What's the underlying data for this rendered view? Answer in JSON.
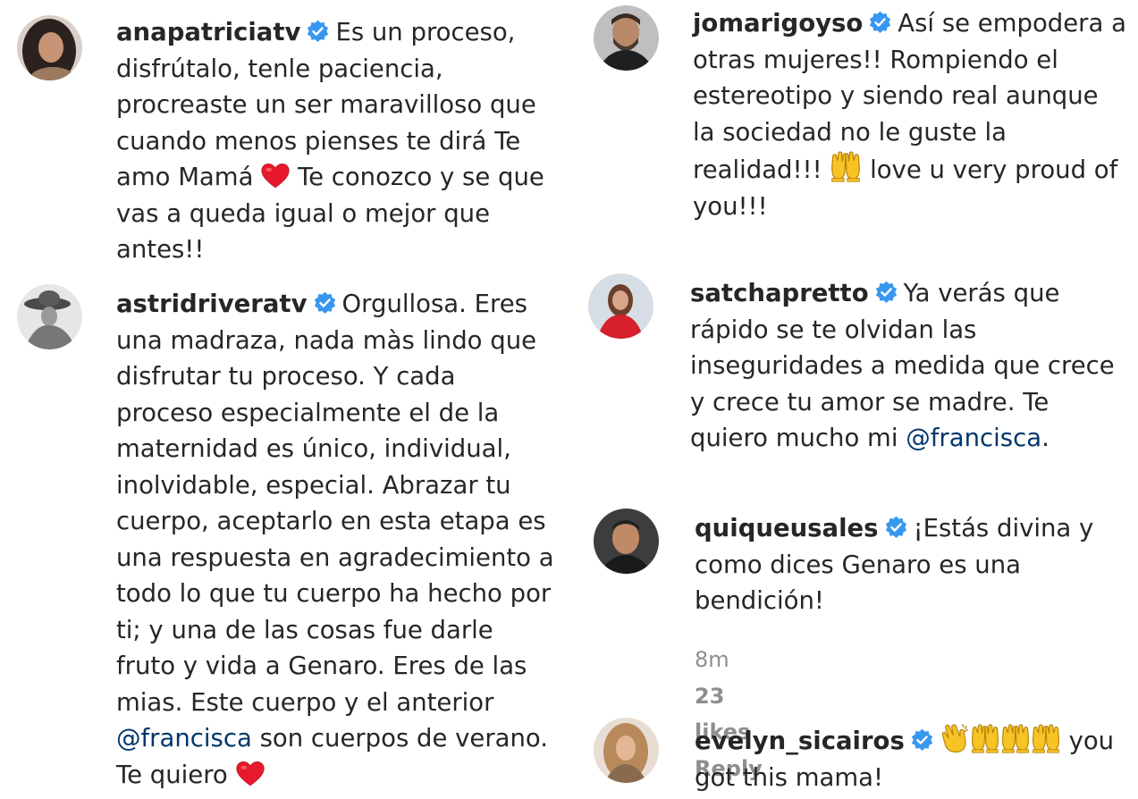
{
  "colors": {
    "mention": "#00376b",
    "verified": "#3897f0",
    "text": "#262626",
    "meta": "#8e8e8e",
    "heart": "#e8192c",
    "emoji_yellow": "#f7c325"
  },
  "icons": {
    "verified": "verified-badge-icon",
    "heart": "red-heart-emoji",
    "raised_hands": "raising-hands-emoji",
    "clap": "clapping-hands-emoji"
  },
  "comments": [
    {
      "username": "anapatriciatv",
      "text_a": "Es un proceso, disfrútalo, tenle paciencia, procreaste un ser maravilloso que cuando menos pienses te dirá Te amo Mamá",
      "text_b": "Te conozco y se que vas a queda igual o mejor que antes!!"
    },
    {
      "username": "astridriveratv",
      "text_a": "Orgullosa. Eres una madraza, nada màs lindo que disfrutar tu proceso. Y cada proceso especialmente el de la maternidad es único, individual, inolvidable, especial. Abrazar tu cuerpo, aceptarlo en esta etapa es una respuesta en agradecimiento a todo lo que tu cuerpo ha hecho por ti; y una de las cosas fue darle fruto y vida a Genaro. Eres de las mias. Este cuerpo y el anterior",
      "mention": "@francisca",
      "text_b": "son cuerpos de verano. Te quiero"
    },
    {
      "username": "jomarigoyso",
      "text_a": "Así se empodera a otras mujeres!! Rompiendo el estereotipo y siendo real aunque la sociedad no le guste la realidad!!!",
      "text_b": "love u very proud of you!!!"
    },
    {
      "username": "satchapretto",
      "text_a": "Ya verás que rápido se te olvidan las inseguridades a medida que crece y crece tu amor se madre. Te quiero mucho mi",
      "mention": "@francisca",
      "text_b": "."
    },
    {
      "username": "quiqueusales",
      "text_a": "¡Estás divina y como dices Genaro es una bendición!",
      "time": "8m",
      "likes": "23 likes",
      "reply": "Reply"
    },
    {
      "username": "evelyn_sicairos",
      "text_a": "you got this mama!"
    }
  ]
}
